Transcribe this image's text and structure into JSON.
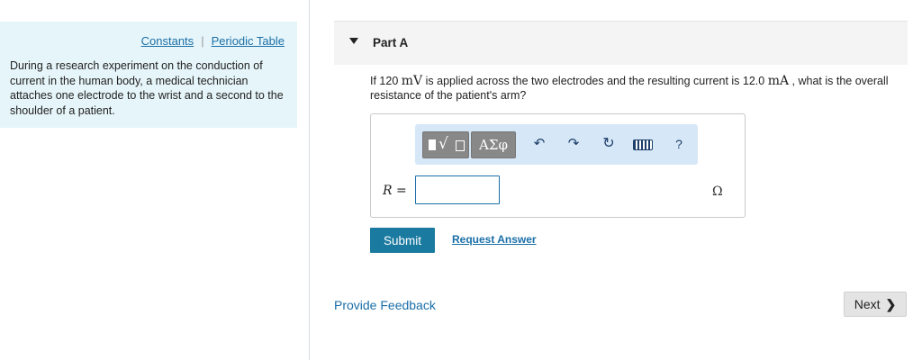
{
  "left_panel": {
    "links": {
      "constants": "Constants",
      "separator": "|",
      "periodic_table": "Periodic Table"
    },
    "problem_text": "During a research experiment on the conduction of current in the human body, a medical technician attaches one electrode to the wrist and a second to the shoulder of a patient."
  },
  "part": {
    "title": "Part A",
    "question": {
      "pre": "If 120 ",
      "unit1": "mV",
      "mid": " is applied across the two electrodes and the resulting current is 12.0 ",
      "unit2": "mA",
      "post": " , what is the overall resistance of the patient's arm?"
    }
  },
  "answer": {
    "toolbar": {
      "greek": "ΑΣφ",
      "undo": "↶",
      "redo": "↷",
      "reset": "↻",
      "help": "?"
    },
    "variable": "R",
    "equals": " =",
    "input_value": "",
    "unit": "Ω"
  },
  "actions": {
    "submit": "Submit",
    "request_answer": "Request Answer"
  },
  "footer": {
    "feedback": "Provide Feedback",
    "next": "Next",
    "next_chevron": "❯"
  }
}
